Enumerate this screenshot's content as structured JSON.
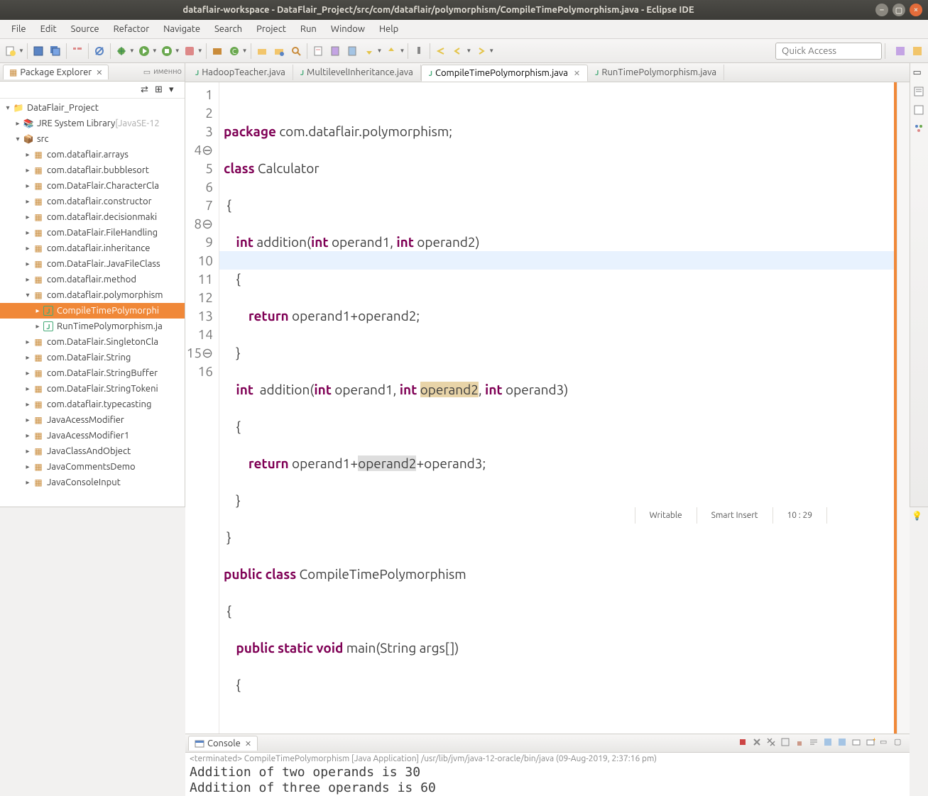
{
  "titlebar": {
    "title": "dataflair-workspace - DataFlair_Project/src/com/dataflair/polymorphism/CompileTimePolymorphism.java - Eclipse IDE"
  },
  "menu": {
    "file": "File",
    "edit": "Edit",
    "source": "Source",
    "refactor": "Refactor",
    "navigate": "Navigate",
    "search": "Search",
    "project": "Project",
    "run": "Run",
    "window": "Window",
    "help": "Help"
  },
  "toolbar": {
    "quick_placeholder": "Quick Access"
  },
  "pkgexp": {
    "title": "Package Explorer",
    "project": "DataFlair_Project",
    "jre": "JRE System Library",
    "jre_suffix": " [JavaSE-12",
    "src": "src",
    "packages": [
      "com.dataflair.arrays",
      "com.dataflair.bubblesort",
      "com.DataFlair.CharacterCla",
      "com.dataflair.constructor",
      "com.dataflair.decisionmaki",
      "com.DataFlair.FileHandling",
      "com.dataflair.inheritance",
      "com.DataFlair.JavaFileClass",
      "com.dataflair.method"
    ],
    "open_package": "com.dataflair.polymorphism",
    "open_files": [
      "CompileTimePolymorphi",
      "RunTimePolymorphism.ja"
    ],
    "packages_after": [
      "com.DataFlair.SingletonCla",
      "com.DataFlair.String",
      "com.DataFlair.StringBuffer",
      "com.DataFlair.StringTokeni",
      "com.dataflair.typecasting",
      "JavaAcessModifier",
      "JavaAcessModifier1",
      "JavaClassAndObject",
      "JavaCommentsDemo",
      "JavaConsoleInput"
    ]
  },
  "tabs": {
    "t1": "HadoopTeacher.java",
    "t2": "MultilevelInheritance.java",
    "t3": "CompileTimePolymorphism.java",
    "t4": "RunTimePolymorphism.java"
  },
  "code": {
    "l1a": "package",
    "l1b": " com.dataflair.polymorphism;",
    "l2a": "class",
    "l2b": " Calculator",
    "l3": " {",
    "l4a": "    ",
    "l4b": "int",
    "l4c": " addition(",
    "l4d": "int",
    "l4e": " operand1, ",
    "l4f": "int",
    "l4g": " operand2)",
    "l5": "    {",
    "l6a": "        ",
    "l6b": "return",
    "l6c": " operand1+operand2;",
    "l7": "    }",
    "l8a": "    ",
    "l8b": "int",
    "l8c": "  addition(",
    "l8d": "int",
    "l8e": " operand1, ",
    "l8f": "int",
    "l8g": " ",
    "l8h": "operand2",
    "l8i": ", ",
    "l8j": "int",
    "l8k": " operand3)",
    "l9": "    {",
    "l10a": "        ",
    "l10b": "return",
    "l10c": " operand1+",
    "l10d": "operand2",
    "l10e": "+operand3;",
    "l11": "    }",
    "l12": " }",
    "l13a": "public",
    "l13b": " ",
    "l13c": "class",
    "l13d": " CompileTimePolymorphism",
    "l14": " {",
    "l15a": "    ",
    "l15b": "public",
    "l15c": " ",
    "l15d": "static",
    "l15e": " ",
    "l15f": "void",
    "l15g": " main(String args[])",
    "l16": "    {"
  },
  "console": {
    "title": "Console",
    "meta": "<terminated> CompileTimePolymorphism [Java Application] /usr/lib/jvm/java-12-oracle/bin/java (09-Aug-2019, 2:37:16 pm)",
    "out": "Addition of two operands is 30\nAddition of three operands is 60"
  },
  "status": {
    "writable": "Writable",
    "insert": "Smart Insert",
    "pos": "10 : 29"
  }
}
